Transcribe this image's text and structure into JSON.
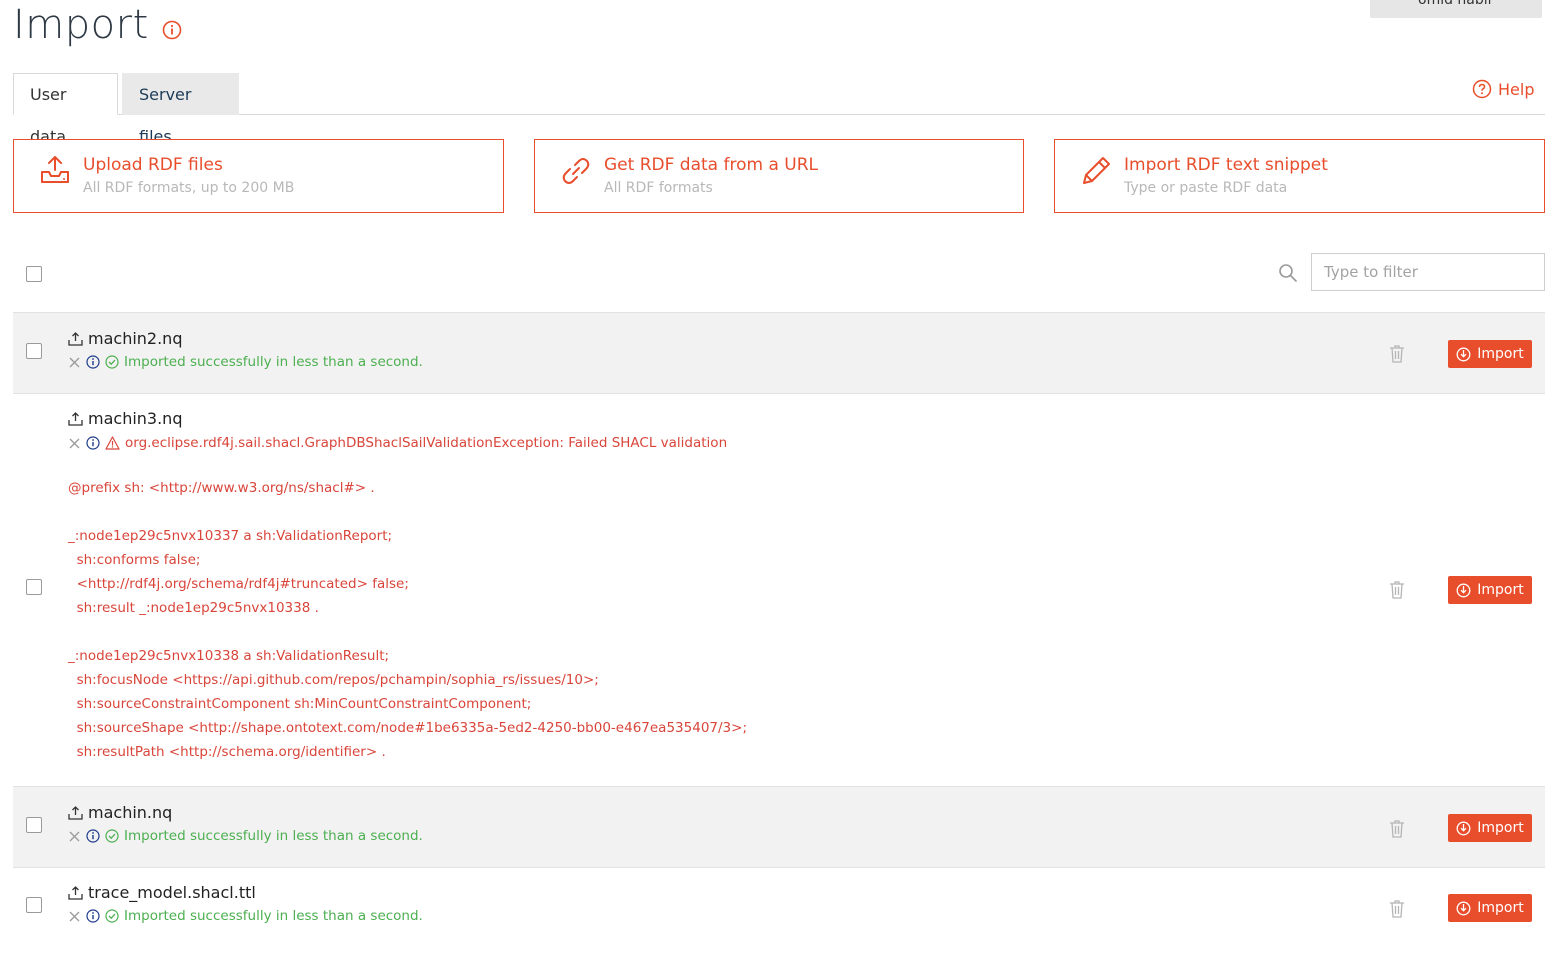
{
  "header": {
    "title": "Import",
    "user_label": "omid  habil"
  },
  "tabs": [
    {
      "label": "User data"
    },
    {
      "label": "Server files"
    }
  ],
  "help": {
    "label": "Help"
  },
  "actions": [
    {
      "title": "Upload RDF files",
      "subtitle": "All RDF formats, up to 200 MB",
      "icon": "upload-icon"
    },
    {
      "title": "Get RDF data from a URL",
      "subtitle": "All RDF formats",
      "icon": "link-icon"
    },
    {
      "title": "Import RDF text snippet",
      "subtitle": "Type or paste RDF data",
      "icon": "pencil-icon"
    }
  ],
  "filter": {
    "placeholder": "Type to filter",
    "value": ""
  },
  "import_label": "Import",
  "files": [
    {
      "name": "machin2.nq",
      "status": "ok",
      "message": "Imported successfully in less than a second.",
      "details": ""
    },
    {
      "name": "machin3.nq",
      "status": "error",
      "message": "org.eclipse.rdf4j.sail.shacl.GraphDBShaclSailValidationException: Failed SHACL validation",
      "details": "@prefix sh: <http://www.w3.org/ns/shacl#> .\n\n_:node1ep29c5nvx10337 a sh:ValidationReport;\n  sh:conforms false;\n  <http://rdf4j.org/schema/rdf4j#truncated> false;\n  sh:result _:node1ep29c5nvx10338 .\n\n_:node1ep29c5nvx10338 a sh:ValidationResult;\n  sh:focusNode <https://api.github.com/repos/pchampin/sophia_rs/issues/10>;\n  sh:sourceConstraintComponent sh:MinCountConstraintComponent;\n  sh:sourceShape <http://shape.ontotext.com/node#1be6335a-5ed2-4250-bb00-e467ea535407/3>;\n  sh:resultPath <http://schema.org/identifier> ."
    },
    {
      "name": "machin.nq",
      "status": "ok",
      "message": "Imported successfully in less than a second.",
      "details": ""
    },
    {
      "name": "trace_model.shacl.ttl",
      "status": "ok",
      "message": "Imported successfully in less than a second.",
      "details": ""
    }
  ],
  "colors": {
    "accent": "#e84e2c",
    "success": "#4caf50",
    "error": "#d9453a",
    "info": "#1b3a8a"
  }
}
